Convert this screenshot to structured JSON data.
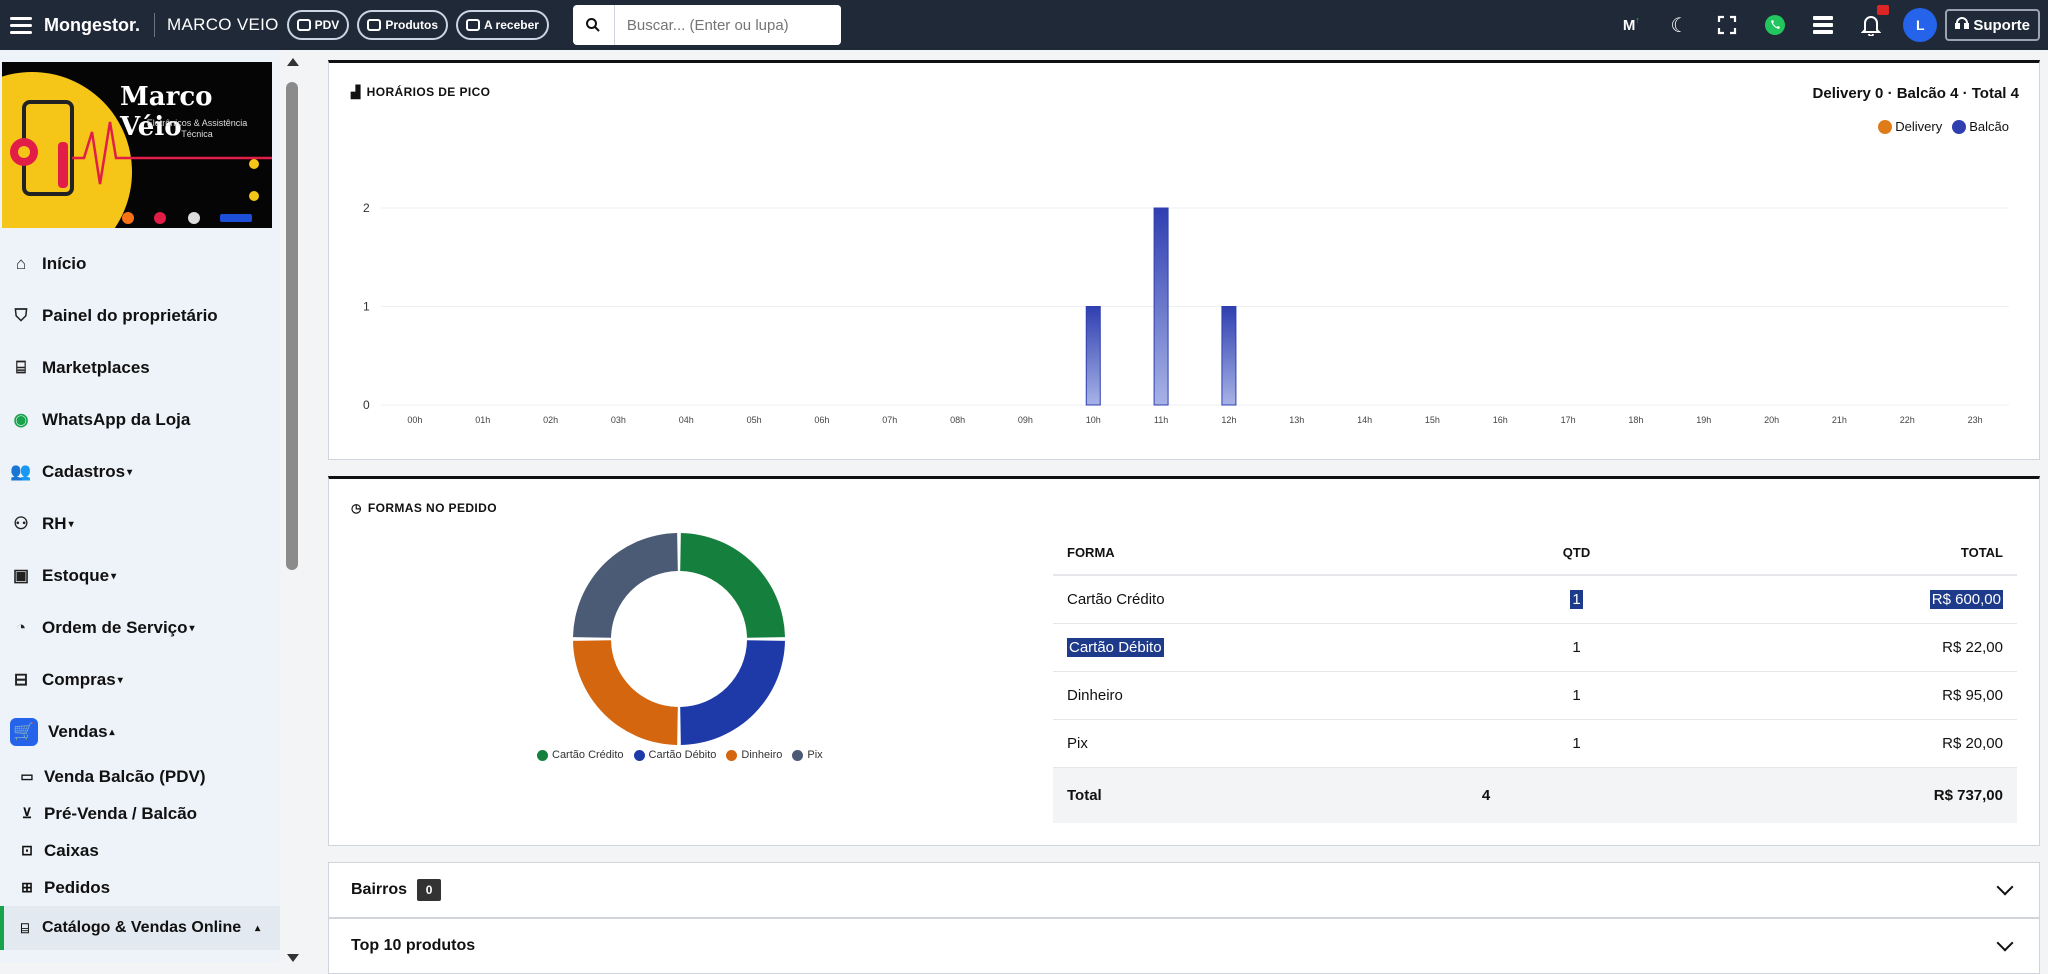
{
  "topbar": {
    "brand": "Mongestor.",
    "store": "MARCO VEIO",
    "pills": [
      "PDV",
      "Produtos",
      "A receber"
    ],
    "search_placeholder": "Buscar... (Enter ou lupa)",
    "avatar": "L",
    "support_label": "Suporte",
    "icons": [
      "menu-icon",
      "search-icon",
      "m-icon",
      "moon-icon",
      "fullscreen-icon",
      "whatsapp-icon",
      "apps-icon",
      "bell-icon",
      "headset-icon"
    ]
  },
  "logo": {
    "name": "Marco Véio",
    "subtitle": "Eletrônicos & Assistência Técnica"
  },
  "sidebar": {
    "items": [
      {
        "label": "Início",
        "icon": "home-icon",
        "caret": false
      },
      {
        "label": "Painel do proprietário",
        "icon": "shield-icon",
        "caret": false
      },
      {
        "label": "Marketplaces",
        "icon": "store-icon",
        "caret": false
      },
      {
        "label": "WhatsApp da Loja",
        "icon": "whatsapp-icon",
        "caret": false
      },
      {
        "label": "Cadastros",
        "icon": "users-icon",
        "caret": true
      },
      {
        "label": "RH",
        "icon": "team-icon",
        "caret": true
      },
      {
        "label": "Estoque",
        "icon": "box-icon",
        "caret": true
      },
      {
        "label": "Ordem de Serviço",
        "icon": "gauge-icon",
        "caret": true
      },
      {
        "label": "Compras",
        "icon": "bag-icon",
        "caret": true
      },
      {
        "label": "Vendas",
        "icon": "cart-icon",
        "caret": true
      }
    ],
    "sub_items": [
      {
        "label": "Venda Balcão (PDV)",
        "icon": "register-icon"
      },
      {
        "label": "Pré-Venda / Balcão",
        "icon": "cart-icon"
      },
      {
        "label": "Caixas",
        "icon": "cash-icon"
      },
      {
        "label": "Pedidos",
        "icon": "orders-icon"
      },
      {
        "label": "Catálogo & Vendas Online",
        "icon": "storefront-icon"
      }
    ]
  },
  "peak": {
    "title": "HORÁRIOS DE PICO",
    "summary": "Delivery 0 · Balcão 4 · Total 4",
    "colors": {
      "delivery": "#e07b1a",
      "balcao": "#2f3fb0"
    }
  },
  "chart_data": {
    "type": "bar",
    "categories": [
      "00h",
      "01h",
      "02h",
      "03h",
      "04h",
      "05h",
      "06h",
      "07h",
      "08h",
      "09h",
      "10h",
      "11h",
      "12h",
      "13h",
      "14h",
      "15h",
      "16h",
      "17h",
      "18h",
      "19h",
      "20h",
      "21h",
      "22h",
      "23h"
    ],
    "series": [
      {
        "name": "Delivery",
        "values": [
          0,
          0,
          0,
          0,
          0,
          0,
          0,
          0,
          0,
          0,
          0,
          0,
          0,
          0,
          0,
          0,
          0,
          0,
          0,
          0,
          0,
          0,
          0,
          0
        ]
      },
      {
        "name": "Balcão",
        "values": [
          0,
          0,
          0,
          0,
          0,
          0,
          0,
          0,
          0,
          0,
          1,
          2,
          1,
          0,
          0,
          0,
          0,
          0,
          0,
          0,
          0,
          0,
          0,
          0
        ]
      }
    ],
    "ylim": [
      0,
      2
    ],
    "yticks": [
      0,
      1,
      2
    ],
    "legend": "top-right",
    "grid": true
  },
  "forms": {
    "title": "FORMAS NO PEDIDO",
    "headers": {
      "forma": "FORMA",
      "qtd": "QTD",
      "total": "TOTAL"
    },
    "rows": [
      {
        "forma": "Cartão Crédito",
        "qtd": "1",
        "total": "R$ 600,00"
      },
      {
        "forma": "Cartão Débito",
        "qtd": "1",
        "total": "R$ 22,00"
      },
      {
        "forma": "Dinheiro",
        "qtd": "1",
        "total": "R$ 95,00"
      },
      {
        "forma": "Pix",
        "qtd": "1",
        "total": "R$ 20,00"
      }
    ],
    "total_row": {
      "label": "Total",
      "qtd": "4",
      "total": "R$ 737,00"
    },
    "donut": [
      {
        "name": "Cartão Crédito",
        "value": 1,
        "color": "#15803d"
      },
      {
        "name": "Cartão Débito",
        "value": 1,
        "color": "#1e3aa8"
      },
      {
        "name": "Dinheiro",
        "value": 1,
        "color": "#d4660f"
      },
      {
        "name": "Pix",
        "value": 1,
        "color": "#4b5a75"
      }
    ]
  },
  "sections": [
    {
      "label": "Bairros",
      "badge": "0"
    },
    {
      "label": "Top 10 produtos",
      "badge": ""
    }
  ]
}
